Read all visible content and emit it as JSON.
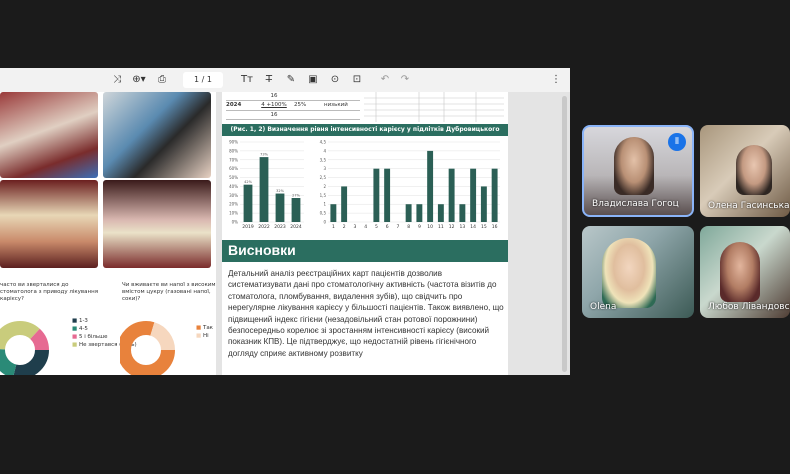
{
  "toolbar": {
    "page_current": "1",
    "page_sep": "/",
    "page_total": "1"
  },
  "left_page": {
    "q1": "часто ви зверталися до стоматолога з приводу лікування карієсу?",
    "q2": "Чи вживаєте ви напої з високим вмістом цукру (газовані напої, соки)?",
    "legend1": [
      "1-3",
      "4-5",
      "5 і більше",
      "Не звертався (лась)"
    ],
    "legend2": [
      "Так",
      "Ні"
    ],
    "colors": {
      "dark": "#1f3e4c",
      "teal": "#2a8a77",
      "olive": "#c9cc7c",
      "pink": "#e66a92",
      "grey": "#cfcfcf",
      "orange": "#e8823c"
    }
  },
  "right_page": {
    "table_rows": [
      {
        "c1": "",
        "c2": "16",
        "c3": "",
        "c4": ""
      },
      {
        "c1": "2024",
        "c2": "4 +100%",
        "c3": "25%",
        "c4": "низький"
      },
      {
        "c1": "",
        "c2": "16",
        "c3": "",
        "c4": ""
      }
    ],
    "chart_caption": "(Рис. 1, 2) Визначення рівня інтенсивності карієсу у підлітків Дубровицького ліцею",
    "section_title": "Висновки",
    "body_text": "Детальний аналіз реєстраційних карт пацієнтів дозволив систематизувати дані про стоматологічну активність (частота візитів до стоматолога, пломбування, видалення зубів), що свідчить про нерегулярне лікування карієсу у більшості пацієнтів. Також виявлено, що підвищений індекс гігієни (незадовільний стан ротової порожнини) безпосередньо корелює зі зростанням інтенсивності карієсу (високий показник КПВ). Це підтверджує, що недостатній рівень гігієнічного догляду сприяє активному розвитку"
  },
  "chart_data": [
    {
      "type": "bar",
      "categories": [
        "2019",
        "2022",
        "2023",
        "2024"
      ],
      "values": [
        42,
        73,
        32,
        27
      ],
      "data_labels": [
        "42%",
        "73%",
        "32%",
        "27%"
      ],
      "ylim": [
        0,
        90
      ],
      "ytick_labels": [
        "0%",
        "10%",
        "20%",
        "30%",
        "40%",
        "50%",
        "60%",
        "70%",
        "80%",
        "90%"
      ],
      "color": "#2b5f55"
    },
    {
      "type": "bar",
      "categories": [
        "1",
        "2",
        "3",
        "4",
        "5",
        "6",
        "7",
        "8",
        "9",
        "10",
        "11",
        "12",
        "13",
        "14",
        "15",
        "16"
      ],
      "values": [
        1,
        2,
        0,
        0,
        3,
        3,
        0,
        1,
        1,
        4,
        1,
        3,
        1,
        3,
        2,
        3
      ],
      "ylim": [
        0,
        4.5
      ],
      "ytick_labels": [
        "0",
        "0,5",
        "1",
        "1,5",
        "2",
        "2,5",
        "3",
        "3,5",
        "4",
        "4,5"
      ],
      "color": "#2b5f55"
    }
  ],
  "participants": [
    {
      "name": "Владислава Гогоц",
      "speaking": true
    },
    {
      "name": "Олена Гасинська",
      "speaking": false
    },
    {
      "name": "Olena",
      "speaking": false
    },
    {
      "name": "Любов Лівандовська",
      "speaking": false
    }
  ]
}
